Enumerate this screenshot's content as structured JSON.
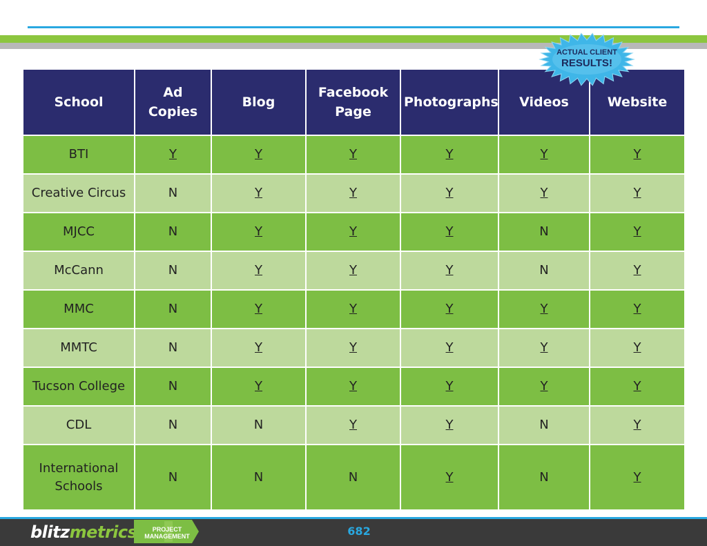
{
  "badge": {
    "line1": "ACTUAL CLIENT",
    "line2": "RESULTS!"
  },
  "table": {
    "headers": [
      [
        "School"
      ],
      [
        "Ad",
        "Copies"
      ],
      [
        "Blog"
      ],
      [
        "Facebook",
        "Page"
      ],
      [
        "Photographs"
      ],
      [
        "Videos"
      ],
      [
        "Website"
      ]
    ],
    "rows": [
      [
        "BTI",
        "Y",
        "Y",
        "Y",
        "Y",
        "Y",
        "Y"
      ],
      [
        "Creative Circus",
        "N",
        "Y",
        "Y",
        "Y",
        "Y",
        "Y"
      ],
      [
        "MJCC",
        "N",
        "Y",
        "Y",
        "Y",
        "N",
        "Y"
      ],
      [
        "McCann",
        "N",
        "Y",
        "Y",
        "Y",
        "N",
        "Y"
      ],
      [
        "MMC",
        "N",
        "Y",
        "Y",
        "Y",
        "Y",
        "Y"
      ],
      [
        "MMTC",
        "N",
        "Y",
        "Y",
        "Y",
        "Y",
        "Y"
      ],
      [
        "Tucson College",
        "N",
        "Y",
        "Y",
        "Y",
        "Y",
        "Y"
      ],
      [
        "CDL",
        "N",
        "N",
        "Y",
        "Y",
        "N",
        "Y"
      ],
      [
        "International Schools",
        "N",
        "N",
        "N",
        "Y",
        "N",
        "Y"
      ]
    ]
  },
  "footer": {
    "brand_part1": "blitz",
    "brand_part2": "metrics",
    "badge_line1": "PROJECT",
    "badge_line2": "MANAGEMENT",
    "page_number": "682"
  },
  "colors": {
    "header_bg": "#2b2c6e",
    "row_dark": "#7dbe44",
    "row_light": "#bdd99c",
    "yes_text": "#e02020",
    "accent_blue": "#29a8e0",
    "accent_green": "#8cc63f",
    "footer_bg": "#3a3a3a"
  }
}
